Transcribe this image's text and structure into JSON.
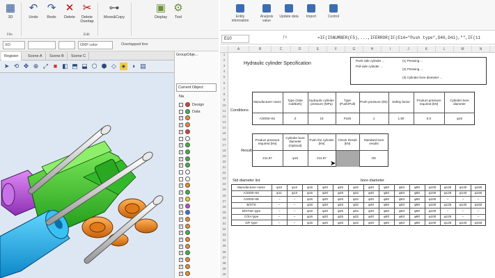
{
  "cad": {
    "ribbon": {
      "buttons": [
        {
          "label": "3D",
          "icon": "3d-view-icon"
        },
        {
          "label": "Undo",
          "icon": "undo-icon"
        },
        {
          "label": "Redo",
          "icon": "redo-icon"
        },
        {
          "label": "Delete",
          "icon": "delete-icon"
        },
        {
          "label": "Delete Overlap",
          "icon": "delete-overlap-icon"
        },
        {
          "label": "Move&Copy",
          "icon": "move-copy-icon"
        },
        {
          "label": "Display",
          "icon": "display-icon"
        },
        {
          "label": "Tool",
          "icon": "tool-icon"
        }
      ],
      "groups": [
        "File",
        "Edit"
      ]
    },
    "options": {
      "mode": "XO",
      "color": "ORP color",
      "line": "Overlapped line"
    },
    "tabs": [
      "Register",
      "Scene A",
      "Scene B",
      "Scene C"
    ],
    "panel": {
      "title": "GroupObje...",
      "combo": "Current Object",
      "header": "Na",
      "layers": [
        {
          "name": "Design",
          "color": "#e23a3a",
          "checked": false
        },
        {
          "name": "Data",
          "color": "#3fb24a",
          "checked": false
        },
        {
          "name": "",
          "color": "#f08a2a",
          "checked": true
        },
        {
          "name": "",
          "color": "#f08a2a",
          "checked": true
        },
        {
          "name": "",
          "color": "#e23a3a",
          "checked": true
        },
        {
          "name": "",
          "color": "#ffffff",
          "checked": false
        },
        {
          "name": "",
          "color": "#3fb24a",
          "checked": true
        },
        {
          "name": "",
          "color": "#3fb24a",
          "checked": true
        },
        {
          "name": "",
          "color": "#3fb24a",
          "checked": true
        },
        {
          "name": "",
          "color": "#3fb24a",
          "checked": true
        },
        {
          "name": "",
          "color": "#ffffff",
          "checked": false
        },
        {
          "name": "",
          "color": "#ffffff",
          "checked": false
        },
        {
          "name": "",
          "color": "#f08a2a",
          "checked": true
        },
        {
          "name": "",
          "color": "#3fb24a",
          "checked": true
        },
        {
          "name": "",
          "color": "#f0d020",
          "checked": true
        },
        {
          "name": "",
          "color": "#b64bd0",
          "checked": true
        },
        {
          "name": "",
          "color": "#3a6fe0",
          "checked": true
        },
        {
          "name": "",
          "color": "#f08a2a",
          "checked": true
        },
        {
          "name": "",
          "color": "#f08a2a",
          "checked": true
        },
        {
          "name": "",
          "color": "#3fb24a",
          "checked": true
        },
        {
          "name": "",
          "color": "#f08a2a",
          "checked": true
        },
        {
          "name": "",
          "color": "#f08a2a",
          "checked": true
        },
        {
          "name": "",
          "color": "#3fb24a",
          "checked": true
        },
        {
          "name": "",
          "color": "#f08a2a",
          "checked": true
        },
        {
          "name": "",
          "color": "#f08a2a",
          "checked": true
        },
        {
          "name": "",
          "color": "#f08a2a",
          "checked": true
        }
      ]
    }
  },
  "excel": {
    "ribbon": [
      "Entity information",
      "Analysis value",
      "Update data",
      "Import",
      "Control"
    ],
    "namebox": "E10",
    "formula": "=IF(ISNUMBER(F5),...,IFERROR(IF(E14=\"Push type\",D40,D41),\"\",IF(11",
    "col_headers": [
      "A",
      "B",
      "C",
      "D",
      "E",
      "F",
      "G",
      "H",
      "I",
      "J",
      "K",
      "L",
      "M",
      "N",
      "O"
    ],
    "title": "Hydraulic cylinder Specification",
    "notes": [
      "Push side cylinder ...",
      "Pull side cylinder ...",
      "(1) Pressing ...",
      "(2) Pressing ...",
      "(3) Cylinder bore diameter ..."
    ],
    "spec": {
      "label": "Conditions",
      "headers": [
        "Manufacturer name",
        "Type (Side rod/Both)",
        "Hydraulic cylinder pressure (MPa)",
        "Type (Push/Pull)",
        "Push pressure (kN)",
        "Safety factor",
        "Product pressure required (kN)",
        "Cylinder bore diameter"
      ],
      "values": [
        "A/2000-HU",
        "Z",
        "15",
        "Push",
        "1",
        "1.50",
        "0.0",
        "φ16"
      ]
    },
    "result": {
      "label": "Result",
      "headers": [
        "Product pressure required (kN)",
        "Cylinder bore diameter (Optimal)",
        "Push the cylinder (kN)",
        "Check Result (kN)",
        "Standard bore results"
      ],
      "values": [
        "211.87",
        "φ16",
        "211.87",
        "",
        "OK"
      ]
    },
    "table": {
      "title": "Std diameter list",
      "bore_header": "bore diameter",
      "col_headers": [
        "Manufacturer name",
        "φ10",
        "φ12",
        "φ16",
        "φ20",
        "φ25",
        "φ32",
        "φ40",
        "φ50",
        "φ63",
        "φ80",
        "φ100",
        "φ125",
        "φ140",
        "φ160"
      ],
      "rows": [
        [
          "Manufacturer name",
          "φ10",
          "φ12",
          "φ16",
          "φ20",
          "φ25",
          "φ32",
          "φ40",
          "φ50",
          "φ63",
          "φ80",
          "φ100",
          "φ125",
          "φ140",
          "φ160"
        ],
        [
          "A/2000-HU",
          "φ11",
          "φ13",
          "φ16",
          "φ20",
          "φ25",
          "φ32",
          "φ40",
          "φ50",
          "φ63",
          "φ80",
          "φ100",
          "φ125",
          "φ140",
          "φ160"
        ],
        [
          "A/2000-HE",
          "–",
          "–",
          "φ16",
          "φ20",
          "φ25",
          "φ32",
          "φ40",
          "φ50",
          "φ63",
          "φ80",
          "φ100",
          "–",
          "–",
          "–"
        ],
        [
          "B/STS",
          "–",
          "–",
          "φ16",
          "φ20",
          "φ25",
          "φ32",
          "φ40",
          "φ50",
          "φ63",
          "φ80",
          "φ100",
          "φ125",
          "φ140",
          "φ160"
        ],
        [
          "B/STSE type",
          "–",
          "–",
          "φ16",
          "φ20",
          "φ25",
          "φ32",
          "φ40",
          "φ50",
          "φ63",
          "φ80",
          "φ100",
          "–",
          "–",
          "–"
        ],
        [
          "C/SA type",
          "–",
          "–",
          "φ16",
          "φ20",
          "φ25",
          "φ32",
          "φ40",
          "φ50",
          "φ63",
          "φ80",
          "φ100",
          "φ125",
          "–",
          "–"
        ],
        [
          "D/F type",
          "–",
          "–",
          "φ16",
          "φ20",
          "φ25",
          "φ32",
          "φ40",
          "φ50",
          "φ63",
          "φ80",
          "φ100",
          "φ125",
          "φ140",
          "φ160"
        ]
      ]
    }
  }
}
